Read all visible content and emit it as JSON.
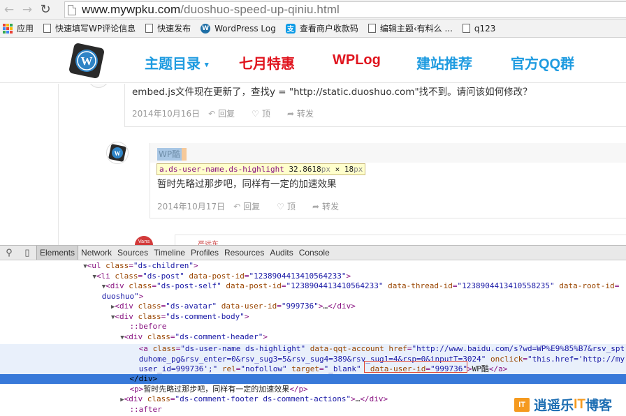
{
  "browser": {
    "url_host": "www.mywpku.com",
    "url_path": "/duoshuo-speed-up-qiniu.html",
    "bookmarks": [
      "应用",
      "快速填写WP评论信息",
      "快速发布",
      "WordPress Log",
      "查看商户收款码",
      "编辑主题‹有料么 ...",
      "q123"
    ]
  },
  "site": {
    "menu": [
      {
        "label": "主题目录",
        "color": "#1e9be0",
        "caret": "▾"
      },
      {
        "label": "七月特惠",
        "color": "#e0141e"
      },
      {
        "label": "WPLog",
        "color": "#e0141e"
      },
      {
        "label": "建站推荐",
        "color": "#1e9be0"
      },
      {
        "label": "官方QQ群",
        "color": "#1e9be0"
      }
    ]
  },
  "comments": {
    "c1": {
      "text": "embed.js文件现在更新了，查找y = \"http://static.duoshuo.com\"找不到。请问该如何修改？",
      "date": "2014年10月16日",
      "reply": "回复",
      "like": "顶",
      "share": "转发"
    },
    "c2": {
      "name": "WP酷",
      "text": "暂时先略过那步吧，同样有一定的加速效果",
      "date": "2014年10月17日",
      "reply": "回复",
      "like": "顶",
      "share": "转发"
    },
    "c3": {
      "avatar_text": "Vans",
      "name": "严远东"
    }
  },
  "tooltip": {
    "selector": "a.ds-user-name.ds-highlight",
    "w": "32.8618",
    "unit": "px",
    "times": " × ",
    "h": "18"
  },
  "devtools": {
    "tabs": [
      "Elements",
      "Network",
      "Sources",
      "Timeline",
      "Profiles",
      "Resources",
      "Audits",
      "Console"
    ],
    "active_tab": "Elements"
  },
  "watermark": {
    "pre": "逍遥乐",
    "it": "IT",
    "post": "博客"
  }
}
